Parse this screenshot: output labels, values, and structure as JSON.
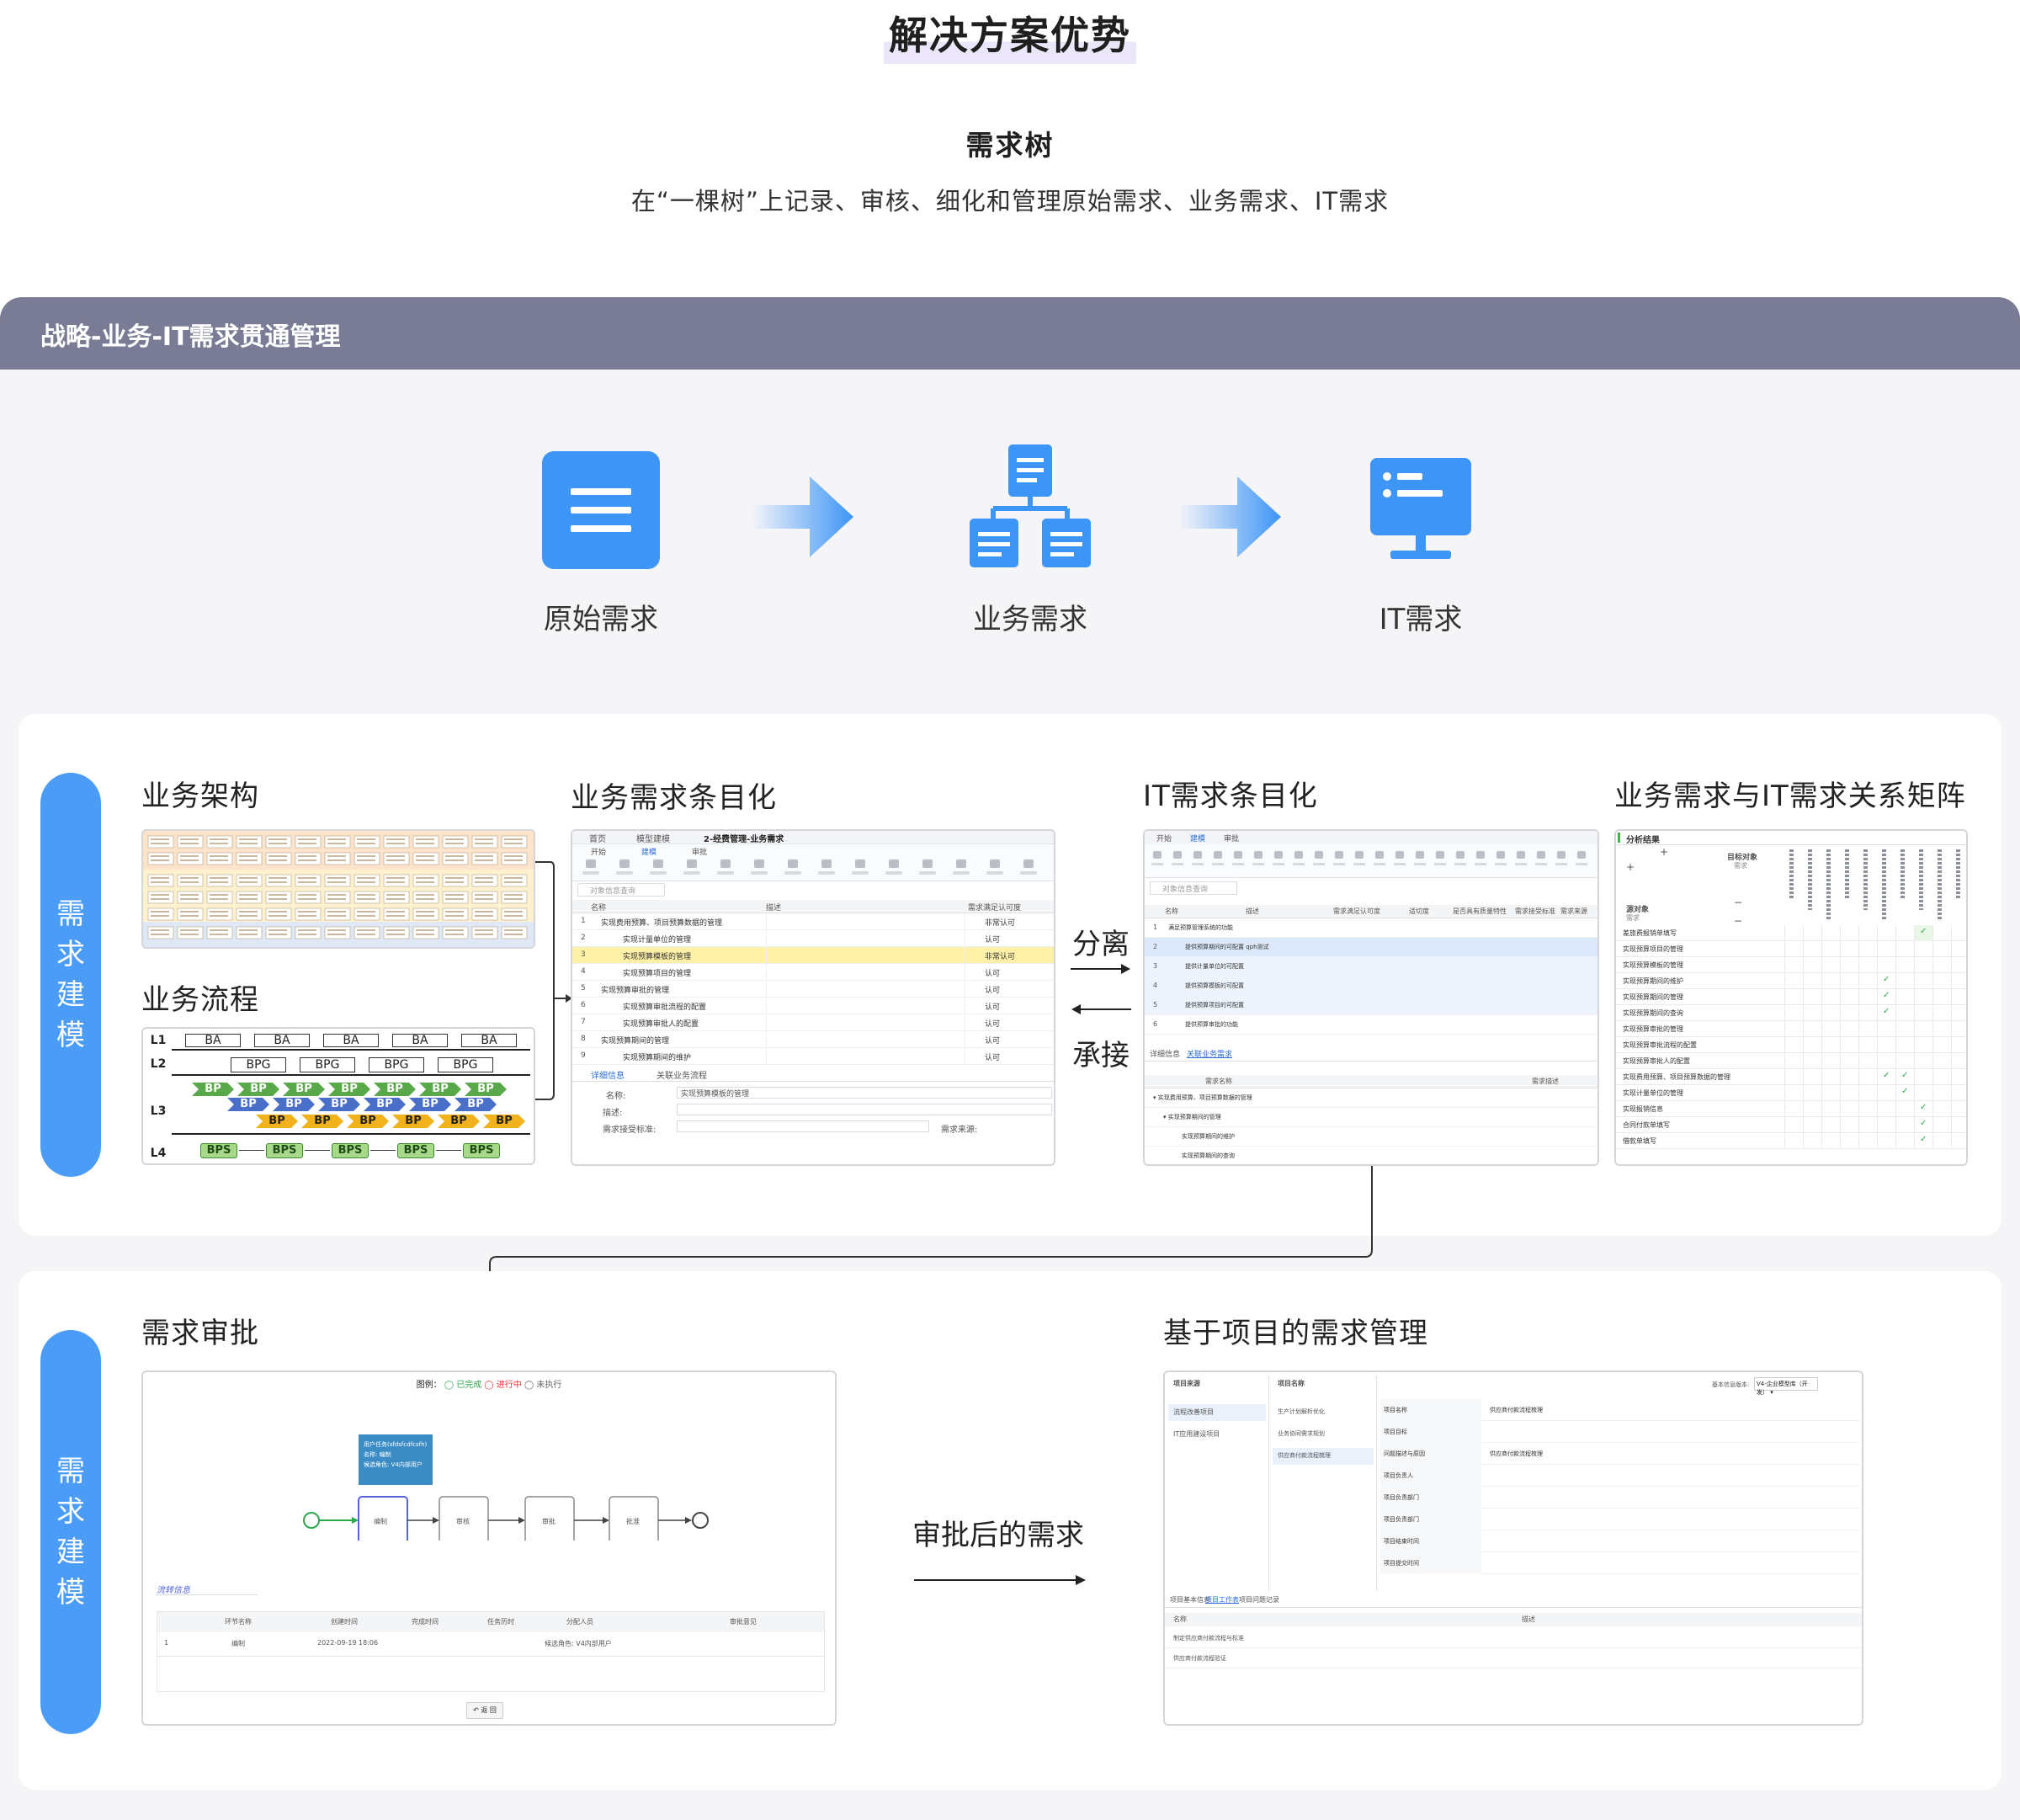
{
  "header": {
    "title": "解决方案优势",
    "subtitle": "需求树",
    "description": "在“一棵树”上记录、审核、细化和管理原始需求、业务需求、IT需求"
  },
  "banner": {
    "label": "战略-业务-IT需求贯通管理"
  },
  "flow": {
    "steps": [
      {
        "label": "原始需求",
        "icon": "document-icon"
      },
      {
        "label": "业务需求",
        "icon": "hierarchy-icon"
      },
      {
        "label": "IT需求",
        "icon": "monitor-icon"
      }
    ],
    "color": "#3d95f6"
  },
  "modeling": {
    "pill": [
      "需",
      "求",
      "建",
      "模"
    ],
    "sections": {
      "business_arch": "业务架构",
      "business_flow": "业务流程",
      "biz_itemize": "业务需求条目化",
      "it_itemize": "IT需求条目化",
      "matrix": "业务需求与IT需求关系矩阵"
    },
    "split_label": "分离",
    "inherit_label": "承接",
    "flow_levels": [
      "L1",
      "L2",
      "L3",
      "L4"
    ],
    "flow_chips": {
      "ba": "BA",
      "bpg": "BPG",
      "bp": "BP",
      "bps": "BPS"
    }
  },
  "biz_table": {
    "tabs": [
      "首页",
      "模型建模",
      "2-经费管理-业务需求"
    ],
    "toolbar": [
      "开始",
      "建模",
      "审批"
    ],
    "search_placeholder": "对象信息查询",
    "columns": [
      "名称",
      "描述",
      "需求满足认可度"
    ],
    "rows": [
      {
        "no": "1",
        "name": "实现费用预算、项目预算数据的管理",
        "val": "非常认可"
      },
      {
        "no": "2",
        "name": "实现计量单位的管理",
        "val": "认可"
      },
      {
        "no": "3",
        "name": "实现预算模板的管理",
        "val": "非常认可"
      },
      {
        "no": "4",
        "name": "实现预算项目的管理",
        "val": "认可"
      },
      {
        "no": "5",
        "name": "实现预算审批的管理",
        "val": "认可"
      },
      {
        "no": "6",
        "name": "实现预算审批流程的配置",
        "val": "认可"
      },
      {
        "no": "7",
        "name": "实现预算审批人的配置",
        "val": "认可"
      },
      {
        "no": "8",
        "name": "实现预算期间的管理",
        "val": "认可"
      },
      {
        "no": "9",
        "name": "实现预算期间的维护",
        "val": "认可"
      }
    ],
    "detail_tabs": [
      "详细信息",
      "关联业务流程"
    ],
    "fields": {
      "name_label": "名称:",
      "name_value": "实现预算模板的管理",
      "desc_label": "描述:",
      "criteria_label": "需求接受标准:",
      "source_label": "需求来源:"
    }
  },
  "it_table": {
    "toolbar": [
      "开始",
      "建模",
      "审批"
    ],
    "search_placeholder": "对象信息查询",
    "columns": [
      "名称",
      "描述",
      "需求满足认可度",
      "适切度",
      "是否具有质量特性",
      "需求接受标准",
      "需求来源"
    ],
    "rows": [
      "满足预算管理系统的功能",
      "提供预算期间的可配置 qph测试",
      "提供计量单位的可配置",
      "提供预算模板的可配置",
      "提供预算项目的可配置",
      "提供预算审批的功能"
    ],
    "tabs": [
      "详细信息",
      "关联业务需求"
    ],
    "sub_columns": [
      "需求名称",
      "需求描述"
    ],
    "sub_rows": [
      "实现费用预算、项目预算数据的管理",
      "实现预算期间的管理",
      "实现预算期间的维护",
      "实现预算期间的查询"
    ]
  },
  "matrix": {
    "title": "分析结果",
    "target_label": "目标对象",
    "target_sub": "需求",
    "source_label": "源对象",
    "source_sub": "需求",
    "rows": [
      "差旅费报销单填写",
      "实现预算项目的管理",
      "实现预算模板的管理",
      "实现预算期间的维护",
      "实现预算期间的管理",
      "实现预算期间的查询",
      "实现预算审批的管理",
      "实现预算审批流程的配置",
      "实现预算审批人的配置",
      "实现费用预算、项目预算数据的管理",
      "实现计量单位的管理",
      "实现报销信息",
      "合同付款单填写",
      "借款单填写"
    ]
  },
  "approval": {
    "pill": [
      "需",
      "求",
      "建",
      "模"
    ],
    "title": "需求审批",
    "legend": {
      "label": "图例：",
      "done": "已完成",
      "running": "进行中",
      "pending": "未执行"
    },
    "tooltip": [
      "用户任务(sfdsfcdfcsfh)",
      "名称: 编制",
      "候选角色: V4内部用户"
    ],
    "nodes": [
      "编制",
      "审核",
      "审批",
      "批准"
    ],
    "info_title": "流转信息",
    "columns": [
      "环节名称",
      "创建时间",
      "完成时间",
      "任务历时",
      "分配人员",
      "审批意见"
    ],
    "row": {
      "no": "1",
      "name": "编制",
      "created": "2022-09-19 18:06",
      "assignee": "候选角色: V4内部用户"
    },
    "back_button": "返 回",
    "arrow_label": "审批后的需求"
  },
  "project": {
    "title": "基于项目的需求管理",
    "left_header": "项目来源",
    "left_items": [
      "流程改善项目",
      "IT应用建设项目"
    ],
    "mid_header": "项目名称",
    "mid_items": [
      "生产计划解析优化",
      "业务协同需求规划",
      "供应商付款流程梳理"
    ],
    "version_label": "基本信息版本:",
    "version_value": "V4-企业模型库（开发）",
    "fields": [
      "项目名称",
      "项目目标",
      "问题描述与原因",
      "项目负责人",
      "项目负责部门",
      "项目负责部门",
      "项目结束时间",
      "项目提交时间"
    ],
    "field_values": [
      "供应商付款流程梳理",
      "供应商付款流程梳理"
    ],
    "tabs": [
      "项目基本信息",
      "项目工作表",
      "项目问题记录"
    ],
    "columns": [
      "名称",
      "描述"
    ],
    "rows": [
      "制定供应商付款流程与标准",
      "供应商付款流程验证"
    ]
  }
}
